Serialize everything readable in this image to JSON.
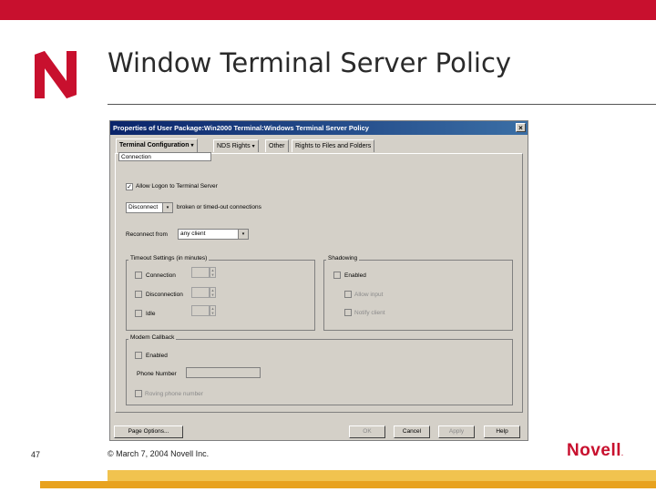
{
  "slide": {
    "title": "Window Terminal Server Policy",
    "page_number": "47",
    "copyright": "© March 7, 2004 Novell Inc.",
    "logo_text": "Novell",
    "logo_mark": "."
  },
  "dialog": {
    "title": "Properties of User Package:Win2000 Terminal:Windows Terminal Server Policy",
    "close_symbol": "×",
    "tabs": [
      {
        "label": "Terminal Configuration",
        "has_dropdown": true
      },
      {
        "label": "NDS Rights",
        "has_dropdown": true
      },
      {
        "label": "Other",
        "has_dropdown": false
      },
      {
        "label": "Rights to Files and Folders",
        "has_dropdown": false
      }
    ],
    "dropdown_caret": "▾",
    "subtab": "Connection",
    "allow_logon": {
      "label": "Allow Logon to Terminal Server",
      "checked": true,
      "mark": "✓"
    },
    "broken_action": {
      "value": "Disconnect",
      "label": "broken or timed-out connections"
    },
    "reconnect": {
      "label": "Reconnect from",
      "value": "any client"
    },
    "timeout_group": {
      "title": "Timeout Settings (in minutes)",
      "items": [
        "Connection",
        "Disconnection",
        "Idle"
      ]
    },
    "shadowing_group": {
      "title": "Shadowing",
      "enabled": "Enabled",
      "allow_input": "Allow input",
      "notify_client": "Notify client"
    },
    "modem_group": {
      "title": "Modem Callback",
      "enabled": "Enabled",
      "phone_label": "Phone Number",
      "roving": "Roving phone number"
    },
    "buttons": {
      "page_options": "Page Options...",
      "ok": "OK",
      "cancel": "Cancel",
      "apply": "Apply",
      "help": "Help"
    }
  },
  "colors": {
    "novell_red": "#c8102e",
    "band_light": "#f1c34f",
    "band_dark": "#e8a21e",
    "titlebar": "#0a246a"
  }
}
